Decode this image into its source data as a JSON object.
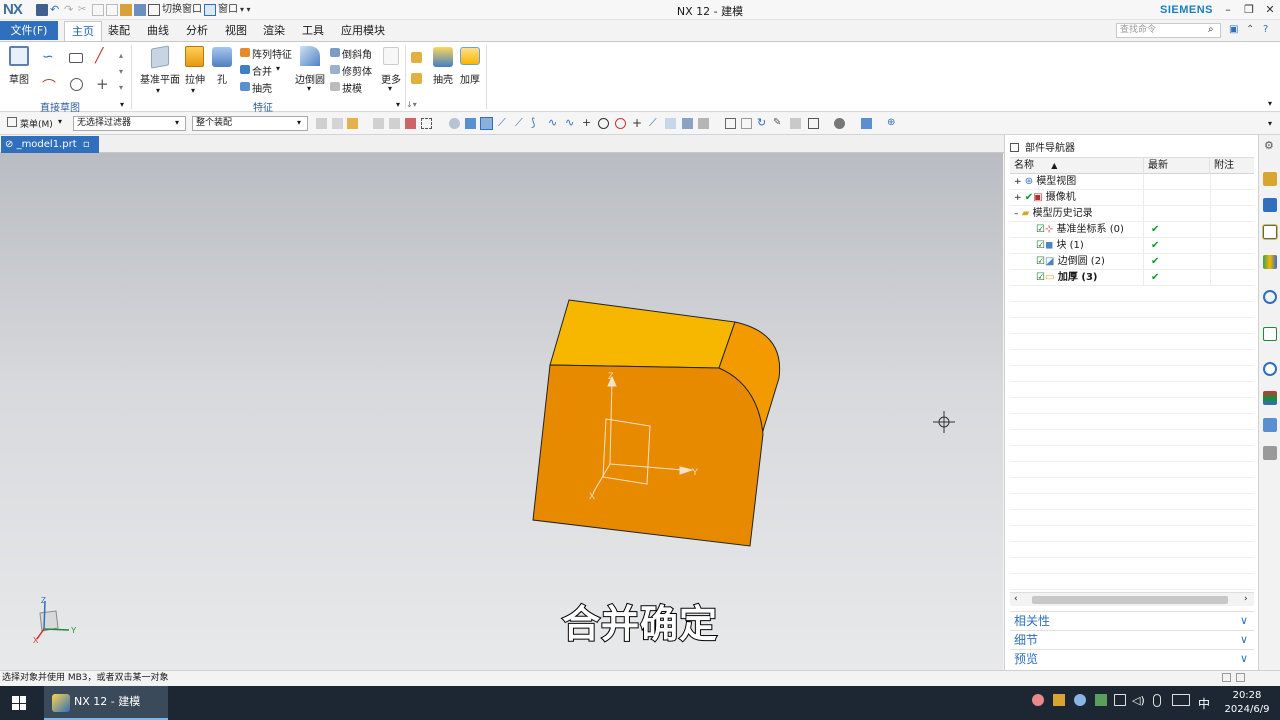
{
  "app": {
    "logo": "NX",
    "window_title": "NX 12 - 建模",
    "brand": "SIEMENS"
  },
  "quick_access": {
    "switch_window": "切换窗口",
    "window": "窗口"
  },
  "menu": {
    "file": "文件(F)",
    "tabs": [
      "主页",
      "装配",
      "曲线",
      "分析",
      "视图",
      "渲染",
      "工具",
      "应用模块"
    ],
    "active_tab": "主页",
    "search_placeholder": "查找命令"
  },
  "ribbon": {
    "sketch": "草图",
    "group_direct_sketch": "直接草图",
    "datum_plane": "基准平面",
    "extrude": "拉伸",
    "hole": "孔",
    "pattern_feature": "阵列特征",
    "unite": "合并",
    "shell_small": "抽壳",
    "edge_blend": "边倒圆",
    "chamfer": "倒斜角",
    "trim_body": "修剪体",
    "draft": "拔模",
    "more": "更多",
    "shell": "抽壳",
    "thicken": "加厚",
    "group_feature": "特征"
  },
  "toolbar": {
    "menu_button": "菜单(M)",
    "filter_value": "无选择过滤器",
    "assembly_scope": "整个装配"
  },
  "document_tab": {
    "name": "_model1.prt"
  },
  "viewport": {
    "triad_labels": {
      "z": "Z",
      "y": "Y",
      "x": "X"
    },
    "caption": "合并确定"
  },
  "navigator": {
    "title": "部件导航器",
    "columns": [
      "名称",
      "最新",
      "附注"
    ],
    "tree": [
      {
        "label": "模型视图",
        "level": 0,
        "latest": ""
      },
      {
        "label": "摄像机",
        "level": 0,
        "latest": ""
      },
      {
        "label": "模型历史记录",
        "level": 0,
        "latest": ""
      },
      {
        "label": "基准坐标系 (0)",
        "level": 1,
        "latest": "✔"
      },
      {
        "label": "块 (1)",
        "level": 1,
        "latest": "✔"
      },
      {
        "label": "边倒圆 (2)",
        "level": 1,
        "latest": "✔"
      },
      {
        "label": "加厚 (3)",
        "level": 1,
        "latest": "✔"
      }
    ],
    "sections": [
      "相关性",
      "细节",
      "预览"
    ]
  },
  "status": {
    "prompt": "选择对象并使用 MB3，或者双击某一对象"
  },
  "taskbar": {
    "app_label": "NX 12 - 建模",
    "ime": "中",
    "time": "20:28",
    "date": "2024/6/9"
  },
  "colors": {
    "accent": "#2f6fbd",
    "part_top": "#f7b600",
    "part_front": "#e88a00",
    "check": "#0a9a2a"
  }
}
